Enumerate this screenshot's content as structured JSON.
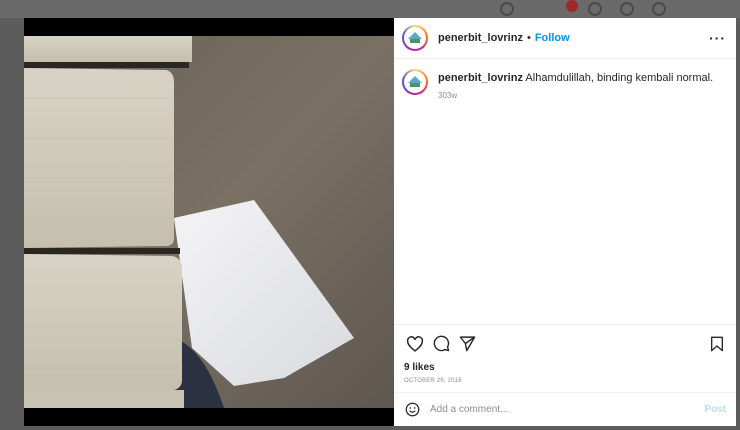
{
  "post": {
    "username": "penerbit_lovrinz",
    "separator": "•",
    "follow_label": "Follow",
    "more_label": "···",
    "caption_username": "penerbit_lovrinz",
    "caption_text": "Alhamdulillah, binding kembali normal.",
    "caption_time": "303w",
    "likes": "9 likes",
    "date": "OCTOBER 26, 2016"
  },
  "comment_box": {
    "placeholder": "Add a comment...",
    "post_label": "Post"
  },
  "icons": {
    "like": "heart-icon",
    "comment": "speech-bubble-icon",
    "share": "paper-plane-icon",
    "save": "bookmark-icon",
    "emoji": "smiley-icon",
    "more": "ellipsis-icon"
  },
  "colors": {
    "follow": "#0095f6",
    "post_disabled": "#b2dffc",
    "text": "#262626",
    "muted": "#8e8e8e"
  }
}
